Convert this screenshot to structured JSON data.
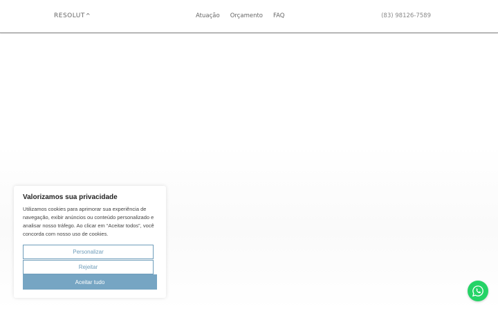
{
  "header": {
    "logo_text": "RESOLUT",
    "logo_caret": "^",
    "nav": [
      "Atuação",
      "Orçamento",
      "FAQ"
    ],
    "phone": "(83) 98126-7589"
  },
  "cookie": {
    "title": "Valorizamos sua privacidade",
    "text": "Utilizamos cookies para aprimorar sua experiência de navegação, exibir anúncios ou conteúdo personalizado e analisar nosso tráfego. Ao clicar em “Aceitar todos”, você concorda com nosso uso de cookies.",
    "customize_label": "Personalizar",
    "reject_label": "Rejeitar",
    "accept_label": "Aceitar tudo"
  },
  "colors": {
    "accent": "#76a5c3",
    "whatsapp": "#25d366"
  },
  "icons": {
    "chat": "whatsapp-icon"
  }
}
